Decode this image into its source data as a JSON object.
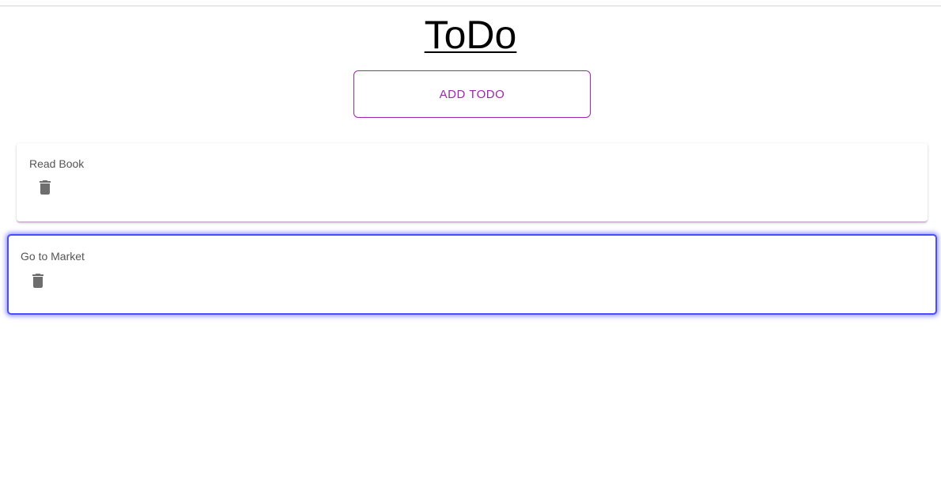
{
  "header": {
    "title": "ToDo",
    "add_button_label": "ADD TODO"
  },
  "todos": [
    {
      "text": "Read Book",
      "delete_icon": "trash-icon"
    },
    {
      "text": "Go to Market",
      "delete_icon": "trash-icon"
    }
  ],
  "colors": {
    "accent": "#9c27b0",
    "focus_outline": "#4b4bff",
    "icon": "#6e6e6e",
    "item_text": "#555555"
  }
}
